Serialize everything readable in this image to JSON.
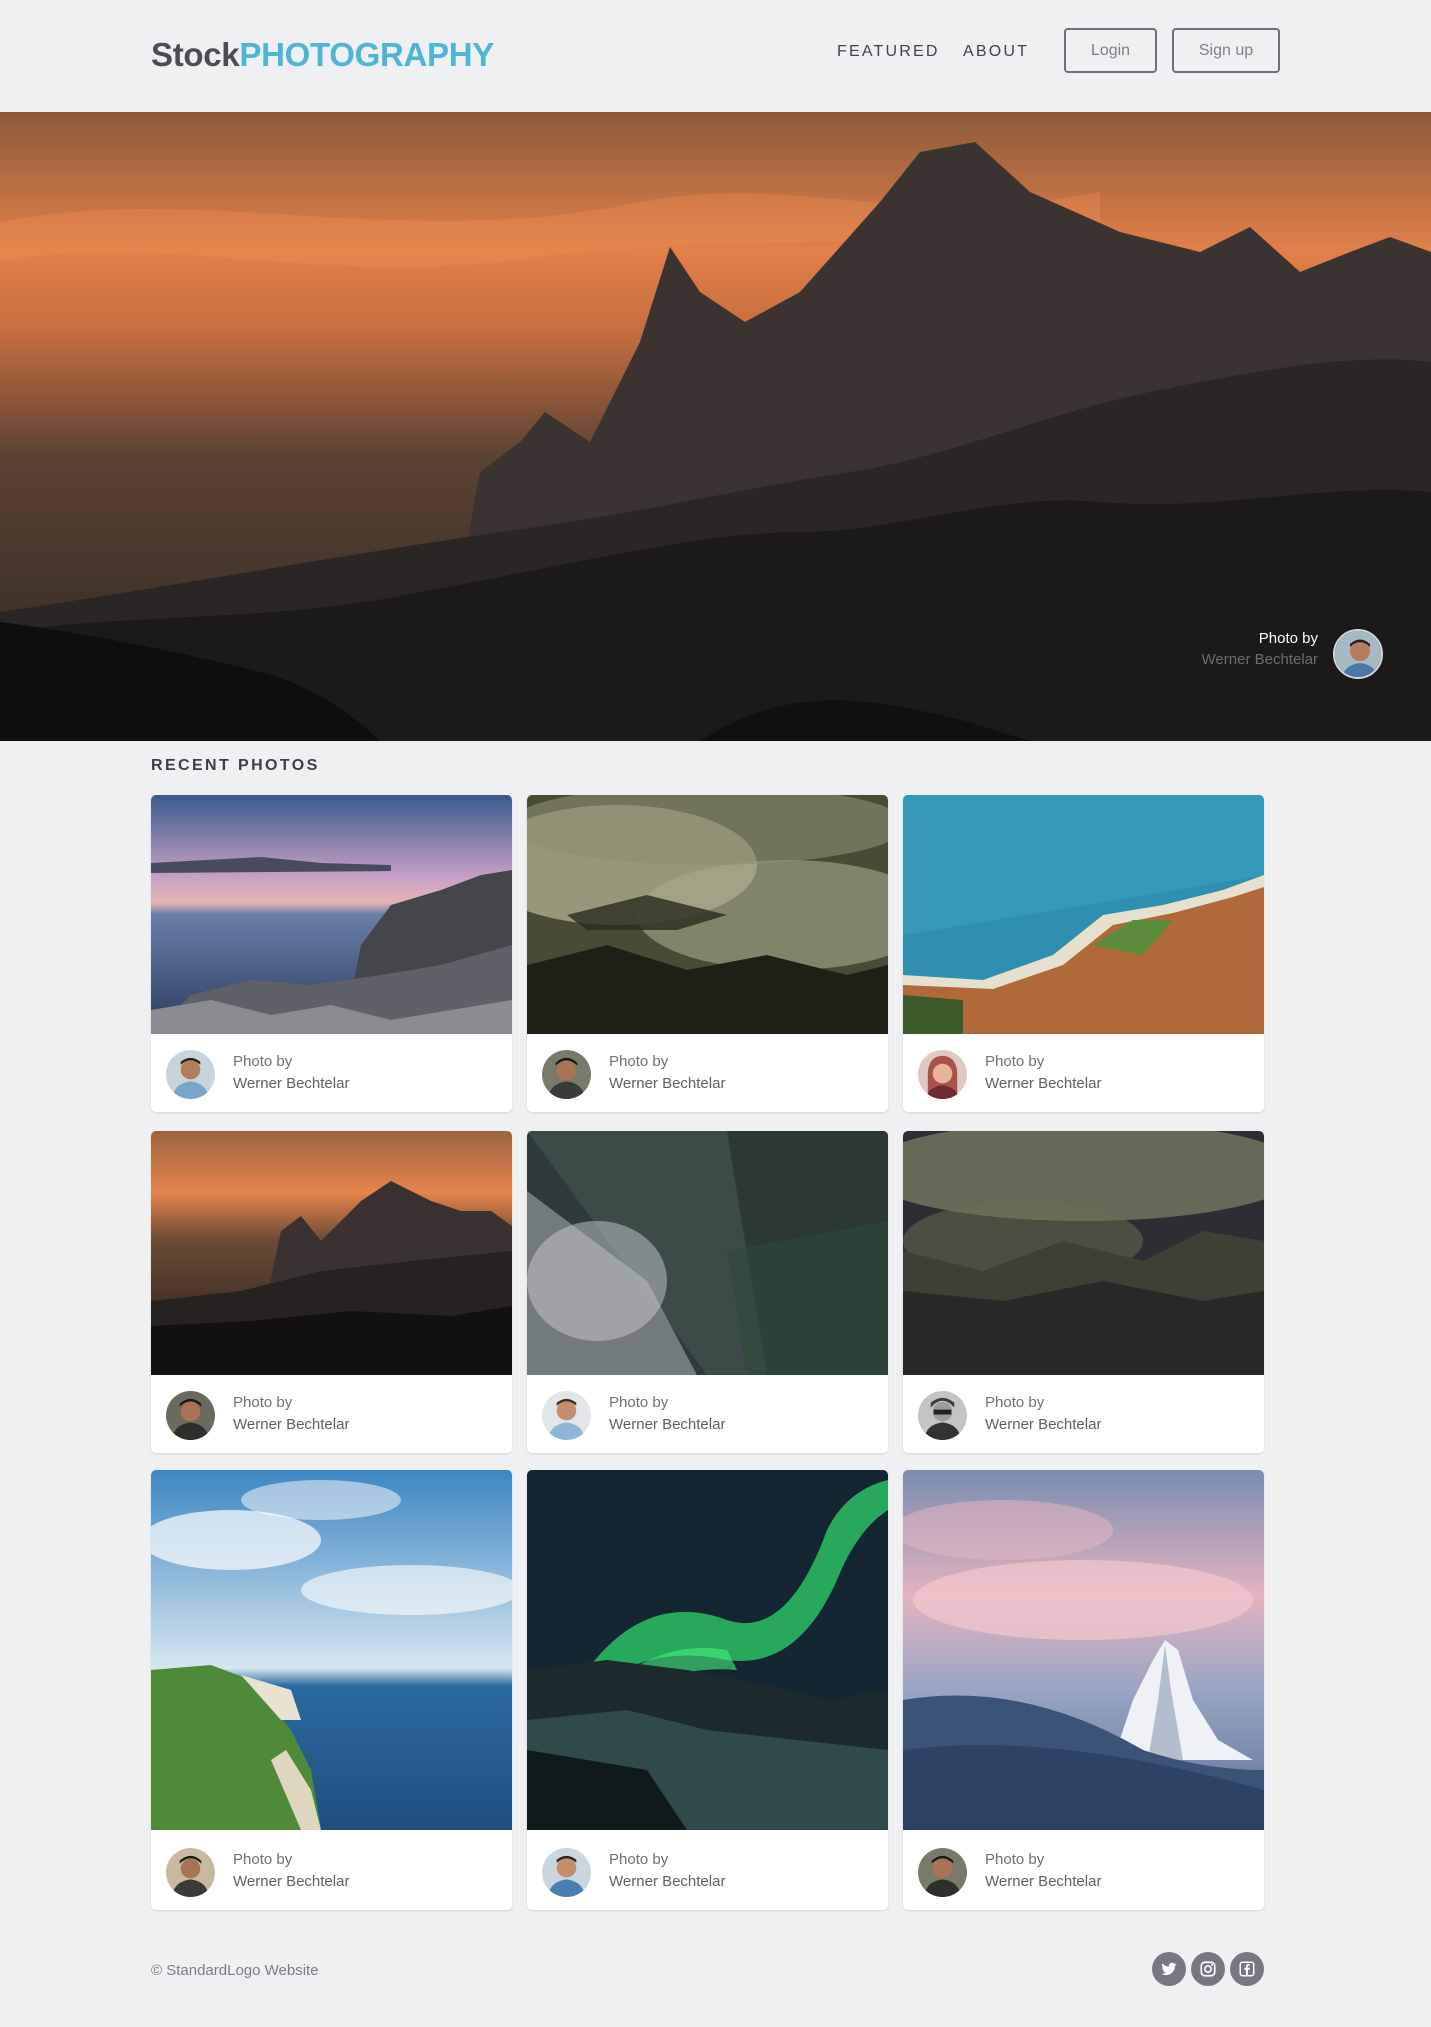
{
  "header": {
    "logo_part1": "Stock",
    "logo_part2": "PHOTOGRAPHY",
    "nav": [
      "FEATURED",
      "ABOUT"
    ],
    "login_label": "Login",
    "signup_label": "Sign up"
  },
  "hero": {
    "credit_prefix": "Photo by",
    "credit_name": "Werner Bechtelar"
  },
  "recent": {
    "title": "RECENT PHOTOS",
    "cards": [
      {
        "prefix": "Photo by",
        "name": "Werner Bechtelar"
      },
      {
        "prefix": "Photo by",
        "name": "Werner Bechtelar"
      },
      {
        "prefix": "Photo by",
        "name": "Werner Bechtelar"
      },
      {
        "prefix": "Photo by",
        "name": "Werner Bechtelar"
      },
      {
        "prefix": "Photo by",
        "name": "Werner Bechtelar"
      },
      {
        "prefix": "Photo by",
        "name": "Werner Bechtelar"
      },
      {
        "prefix": "Photo by",
        "name": "Werner Bechtelar"
      },
      {
        "prefix": "Photo by",
        "name": "Werner Bechtelar"
      },
      {
        "prefix": "Photo by",
        "name": "Werner Bechtelar"
      }
    ]
  },
  "footer": {
    "copyright": "© StandardLogo Website",
    "social_icons": [
      "twitter-icon",
      "instagram-icon",
      "facebook-icon"
    ]
  },
  "colors": {
    "background": "#eff0f2",
    "brand_accent": "#4fb5d6",
    "text_dark": "#4a4d53",
    "card_bg": "#ffffff"
  }
}
